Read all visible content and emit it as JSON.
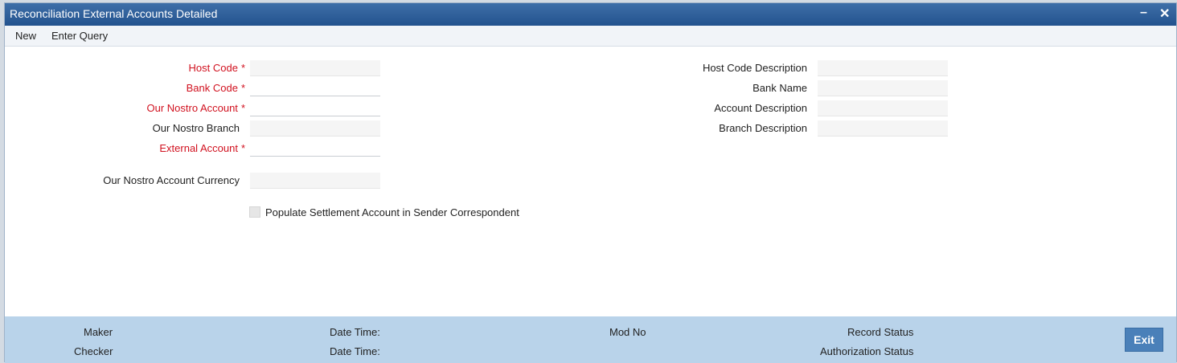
{
  "window": {
    "title": "Reconciliation External Accounts Detailed",
    "minimize_glyph": "–",
    "close_glyph": "✕"
  },
  "menu": {
    "new": "New",
    "enter_query": "Enter Query"
  },
  "form": {
    "host_code": {
      "label": "Host Code",
      "value": ""
    },
    "bank_code": {
      "label": "Bank Code",
      "value": ""
    },
    "our_nostro_account": {
      "label": "Our Nostro Account",
      "value": ""
    },
    "our_nostro_branch": {
      "label": "Our Nostro Branch",
      "value": ""
    },
    "external_account": {
      "label": "External Account",
      "value": ""
    },
    "our_nostro_account_currency": {
      "label": "Our Nostro Account Currency",
      "value": ""
    },
    "host_code_description": {
      "label": "Host Code Description",
      "value": ""
    },
    "bank_name": {
      "label": "Bank Name",
      "value": ""
    },
    "account_description": {
      "label": "Account Description",
      "value": ""
    },
    "branch_description": {
      "label": "Branch Description",
      "value": ""
    },
    "populate_settlement": {
      "label": "Populate Settlement Account in Sender Correspondent",
      "checked": false
    },
    "required_marker": "*"
  },
  "footer": {
    "maker": "Maker",
    "checker": "Checker",
    "date_time_1": "Date Time:",
    "date_time_2": "Date Time:",
    "mod_no": "Mod No",
    "record_status": "Record Status",
    "authorization_status": "Authorization Status",
    "exit": "Exit"
  },
  "colors": {
    "titlebar": "#2a5b96",
    "required_label": "#d1111f",
    "footer": "#b9d3ea",
    "exit_button": "#4a80b9"
  }
}
